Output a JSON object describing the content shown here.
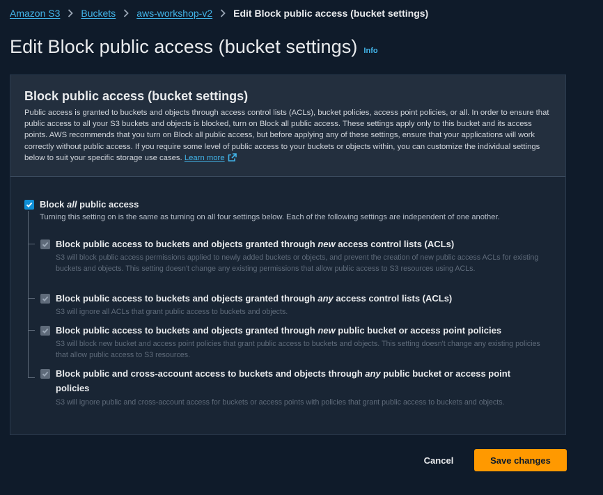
{
  "breadcrumb": {
    "items": [
      "Amazon S3",
      "Buckets",
      "aws-workshop-v2"
    ],
    "current": "Edit Block public access (bucket settings)"
  },
  "page": {
    "title": "Edit Block public access (bucket settings)",
    "info_label": "Info"
  },
  "panel": {
    "title": "Block public access (bucket settings)",
    "description": "Public access is granted to buckets and objects through access control lists (ACLs), bucket policies, access point policies, or all. In order to ensure that public access to all your S3 buckets and objects is blocked, turn on Block all public access. These settings apply only to this bucket and its access points. AWS recommends that you turn on Block all public access, but before applying any of these settings, ensure that your applications will work correctly without public access. If you require some level of public access to your buckets or objects within, you can customize the individual settings below to suit your specific storage use cases.",
    "learn_more": "Learn more"
  },
  "block_all": {
    "label_pre": "Block ",
    "label_em": "all",
    "label_post": " public access",
    "checked": true,
    "description": "Turning this setting on is the same as turning on all four settings below. Each of the following settings are independent of one another."
  },
  "options": [
    {
      "label_pre": "Block public access to buckets and objects granted through ",
      "label_em": "new",
      "label_post": " access control lists (ACLs)",
      "description": "S3 will block public access permissions applied to newly added buckets or objects, and prevent the creation of new public access ACLs for existing buckets and objects. This setting doesn't change any existing permissions that allow public access to S3 resources using ACLs.",
      "checked": true
    },
    {
      "label_pre": "Block public access to buckets and objects granted through ",
      "label_em": "any",
      "label_post": " access control lists (ACLs)",
      "description": "S3 will ignore all ACLs that grant public access to buckets and objects.",
      "checked": true
    },
    {
      "label_pre": "Block public access to buckets and objects granted through ",
      "label_em": "new",
      "label_post": " public bucket or access point policies",
      "description": "S3 will block new bucket and access point policies that grant public access to buckets and objects. This setting doesn't change any existing policies that allow public access to S3 resources.",
      "checked": true
    },
    {
      "label_pre": "Block public and cross-account access to buckets and objects through ",
      "label_em": "any",
      "label_post": " public bucket or access point policies",
      "description": "S3 will ignore public and cross-account access for buckets or access points with policies that grant public access to buckets and objects.",
      "checked": true
    }
  ],
  "actions": {
    "cancel": "Cancel",
    "save": "Save changes"
  },
  "colors": {
    "background": "#0f1b2a",
    "link": "#42b4e8",
    "primary_button": "#ff9900",
    "checkbox_checked": "#0f8fd6",
    "checkbox_disabled": "#5f6b7a"
  }
}
